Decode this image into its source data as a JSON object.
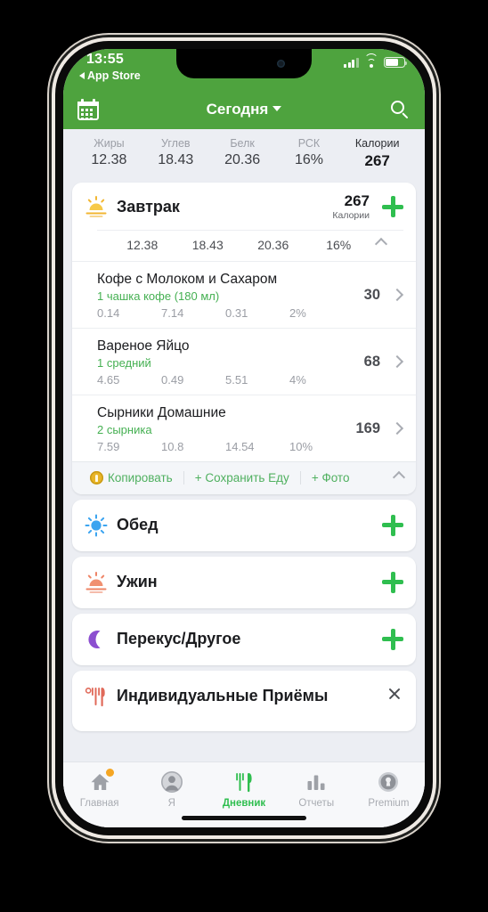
{
  "status_bar": {
    "time": "13:55",
    "back_label": "App Store",
    "signal_icon": "cellular-signal-icon",
    "wifi_icon": "wifi-icon",
    "battery_icon": "battery-icon"
  },
  "nav_bar": {
    "calendar_icon": "calendar-icon",
    "title": "Сегодня",
    "search_icon": "search-icon",
    "bg_color": "#4EA33E"
  },
  "summary": {
    "columns": [
      {
        "label": "Жиры",
        "value": "12.38"
      },
      {
        "label": "Углев",
        "value": "18.43"
      },
      {
        "label": "Белк",
        "value": "20.36"
      },
      {
        "label": "РСК",
        "value": "16%"
      },
      {
        "label": "Калории",
        "value": "267"
      }
    ]
  },
  "breakfast": {
    "icon": "sunrise-icon",
    "name": "Завтрак",
    "calories": "267",
    "calories_label": "Калории",
    "add_icon": "plus-icon",
    "collapse_icon": "chevron-up-icon",
    "macros": [
      "12.38",
      "18.43",
      "20.36",
      "16%"
    ],
    "items": [
      {
        "name": "Кофе с Молоком и Сахаром",
        "serving": "1 чашка кофе (180 мл)",
        "calories": "30",
        "macros": [
          "0.14",
          "7.14",
          "0.31",
          "2%"
        ],
        "arrow_icon": "chevron-right-icon"
      },
      {
        "name": "Вареное Яйцо",
        "serving": "1 средний",
        "calories": "68",
        "macros": [
          "4.65",
          "0.49",
          "5.51",
          "4%"
        ],
        "arrow_icon": "chevron-right-icon"
      },
      {
        "name": "Сырники Домашние",
        "serving": "2 сырника",
        "calories": "169",
        "macros": [
          "7.59",
          "10.8",
          "14.54",
          "10%"
        ],
        "arrow_icon": "chevron-right-icon"
      }
    ],
    "actions": {
      "copy_label": "Копировать",
      "copy_icon": "premium-lock-icon",
      "save_food_label": "+ Сохранить Еду",
      "photo_label": "+ Фото",
      "collapse_icon": "chevron-up-icon"
    }
  },
  "meals": [
    {
      "icon": "sun-icon",
      "name": "Обед",
      "add_icon": "plus-icon"
    },
    {
      "icon": "sunset-icon",
      "name": "Ужин",
      "add_icon": "plus-icon"
    },
    {
      "icon": "moon-icon",
      "name": "Перекус/Другое",
      "add_icon": "plus-icon"
    }
  ],
  "custom_meals": {
    "icon": "cutlery-icon",
    "name": "Индивидуальные Приёмы",
    "close_icon": "close-icon"
  },
  "tab_bar": {
    "items": [
      {
        "icon": "home-icon",
        "label": "Главная",
        "active": false,
        "badge": true
      },
      {
        "icon": "person-icon",
        "label": "Я",
        "active": false,
        "badge": false
      },
      {
        "icon": "cutlery-icon",
        "label": "Дневник",
        "active": true,
        "badge": false
      },
      {
        "icon": "bar-chart-icon",
        "label": "Отчеты",
        "active": false,
        "badge": false
      },
      {
        "icon": "lock-icon",
        "label": "Premium",
        "active": false,
        "badge": false
      }
    ],
    "active_color": "#2FBE4F"
  }
}
